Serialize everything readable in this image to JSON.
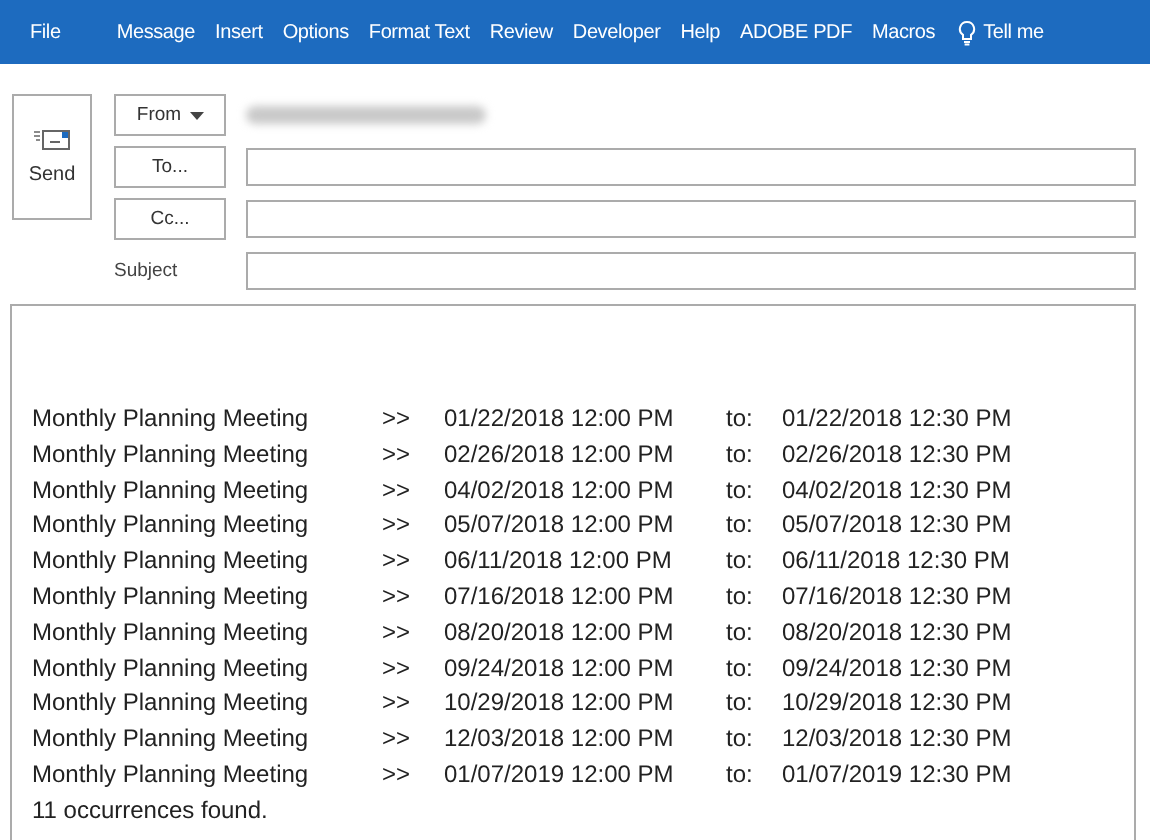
{
  "ribbon": {
    "tabs": [
      {
        "label": "File"
      },
      {
        "label": "Message"
      },
      {
        "label": "Insert"
      },
      {
        "label": "Options"
      },
      {
        "label": "Format Text"
      },
      {
        "label": "Review"
      },
      {
        "label": "Developer"
      },
      {
        "label": "Help"
      },
      {
        "label": "ADOBE PDF"
      },
      {
        "label": "Macros"
      }
    ],
    "tell_me": "Tell me"
  },
  "compose": {
    "send": "Send",
    "from": "From",
    "to": "To...",
    "cc": "Cc...",
    "subject_label": "Subject"
  },
  "body": {
    "rows": [
      {
        "subject": "Monthly Planning Meeting",
        "arrow": ">>",
        "start": "01/22/2018 12:00 PM",
        "to": "to:",
        "end": "01/22/2018 12:30 PM"
      },
      {
        "subject": "Monthly Planning Meeting",
        "arrow": ">>",
        "start": "02/26/2018 12:00 PM",
        "to": "to:",
        "end": "02/26/2018 12:30 PM"
      },
      {
        "subject": "Monthly Planning Meeting",
        "arrow": ">>",
        "start": "04/02/2018 12:00 PM",
        "to": "to:",
        "end": "04/02/2018 12:30 PM"
      },
      {
        "subject": "Monthly Planning Meeting",
        "arrow": ">>",
        "start": "05/07/2018 12:00 PM",
        "to": "to:",
        "end": "05/07/2018 12:30 PM"
      },
      {
        "subject": "Monthly Planning Meeting",
        "arrow": ">>",
        "start": "06/11/2018 12:00 PM",
        "to": "to:",
        "end": "06/11/2018 12:30 PM"
      },
      {
        "subject": "Monthly Planning Meeting",
        "arrow": ">>",
        "start": "07/16/2018 12:00 PM",
        "to": "to:",
        "end": "07/16/2018 12:30 PM"
      },
      {
        "subject": "Monthly Planning Meeting",
        "arrow": ">>",
        "start": "08/20/2018 12:00 PM",
        "to": "to:",
        "end": "08/20/2018 12:30 PM"
      },
      {
        "subject": "Monthly Planning Meeting",
        "arrow": ">>",
        "start": "09/24/2018 12:00 PM",
        "to": "to:",
        "end": "09/24/2018 12:30 PM"
      },
      {
        "subject": "Monthly Planning Meeting",
        "arrow": ">>",
        "start": "10/29/2018 12:00 PM",
        "to": "to:",
        "end": "10/29/2018 12:30 PM"
      },
      {
        "subject": "Monthly Planning Meeting",
        "arrow": ">>",
        "start": "12/03/2018 12:00 PM",
        "to": "to:",
        "end": "12/03/2018 12:30 PM"
      },
      {
        "subject": "Monthly Planning Meeting",
        "arrow": ">>",
        "start": "01/07/2019 12:00 PM",
        "to": "to:",
        "end": "01/07/2019 12:30 PM"
      }
    ],
    "summary": "11 occurrences found."
  }
}
